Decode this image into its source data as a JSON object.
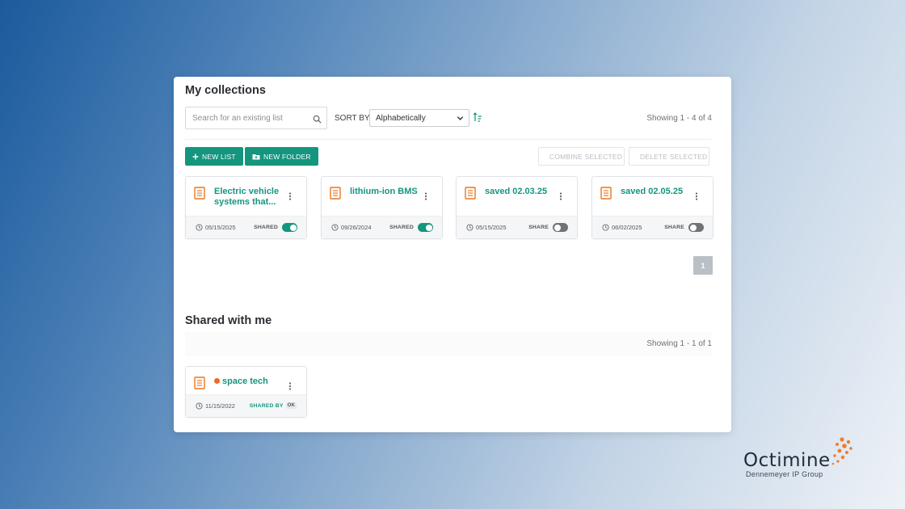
{
  "my_collections": {
    "title": "My collections",
    "search_placeholder": "Search for an existing list",
    "sort_label": "SORT BY:",
    "sort_value": "Alphabetically",
    "showing": "Showing 1 - 4 of 4",
    "buttons": {
      "new_list": "NEW LIST",
      "new_folder": "NEW FOLDER",
      "combine": "COMBINE SELECTED",
      "delete": "DELETE SELECTED"
    },
    "cards": [
      {
        "title": "Electric vehicle systems that...",
        "date": "05/15/2025",
        "share_label": "SHARED",
        "shared": true
      },
      {
        "title": "lithium-ion BMS",
        "date": "09/26/2024",
        "share_label": "SHARED",
        "shared": true
      },
      {
        "title": "saved 02.03.25",
        "date": "05/15/2025",
        "share_label": "SHARE",
        "shared": false
      },
      {
        "title": "saved 02.05.25",
        "date": "06/02/2025",
        "share_label": "SHARE",
        "shared": false
      }
    ],
    "page": "1"
  },
  "shared_with_me": {
    "title": "Shared with me",
    "showing": "Showing 1 - 1 of 1",
    "cards": [
      {
        "title": "space tech",
        "date": "11/15/2022",
        "shared_by_label": "SHARED BY",
        "shared_by_initials": "OK"
      }
    ]
  },
  "logo": {
    "name": "Octimine",
    "subtitle": "Dennemeyer IP Group"
  },
  "colors": {
    "accent": "#14967e",
    "list_icon": "#e87722",
    "unread_dot": "#ef6a22"
  }
}
